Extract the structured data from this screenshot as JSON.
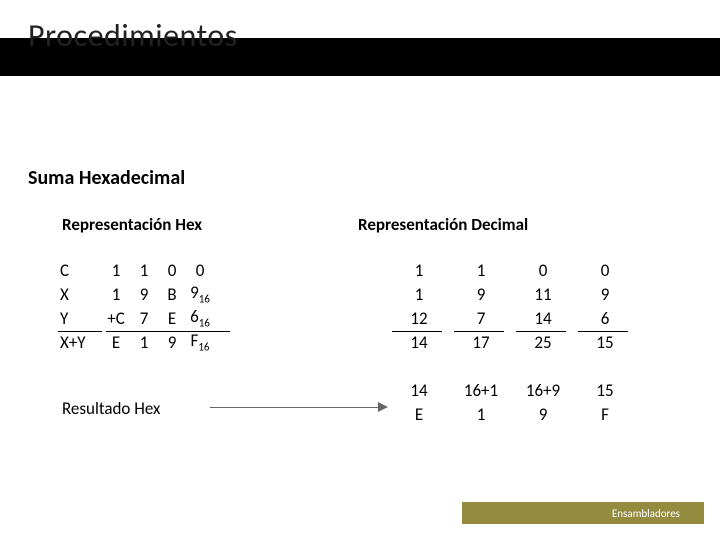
{
  "title": "Procedimientos",
  "subtitle": "Suma Hexadecimal",
  "left": {
    "heading": "Representación  Hex",
    "rows": {
      "c_label": "C",
      "c": [
        "1",
        "1",
        "0",
        "0"
      ],
      "x_label": "X",
      "x": [
        "1",
        "9",
        "B",
        "9"
      ],
      "y_label": "Y",
      "y": [
        "+C",
        "7",
        "E",
        "6"
      ],
      "sum_label": "X+Y",
      "sum": [
        "E",
        "1",
        "9",
        "F"
      ]
    },
    "sub16": "16"
  },
  "right": {
    "heading": "Representación   Decimal",
    "rows": {
      "c": [
        "1",
        "1",
        "0",
        "0"
      ],
      "x": [
        "1",
        "9",
        "11",
        "9"
      ],
      "y": [
        "12",
        "7",
        "14",
        "6"
      ],
      "sum": [
        "14",
        "17",
        "25",
        "15"
      ],
      "breakdown": [
        "14",
        "16+1",
        "16+9",
        "15"
      ],
      "hexout": [
        "E",
        "1",
        "9",
        "F"
      ]
    }
  },
  "result_label": "Resultado Hex",
  "footer": "Ensambladores"
}
